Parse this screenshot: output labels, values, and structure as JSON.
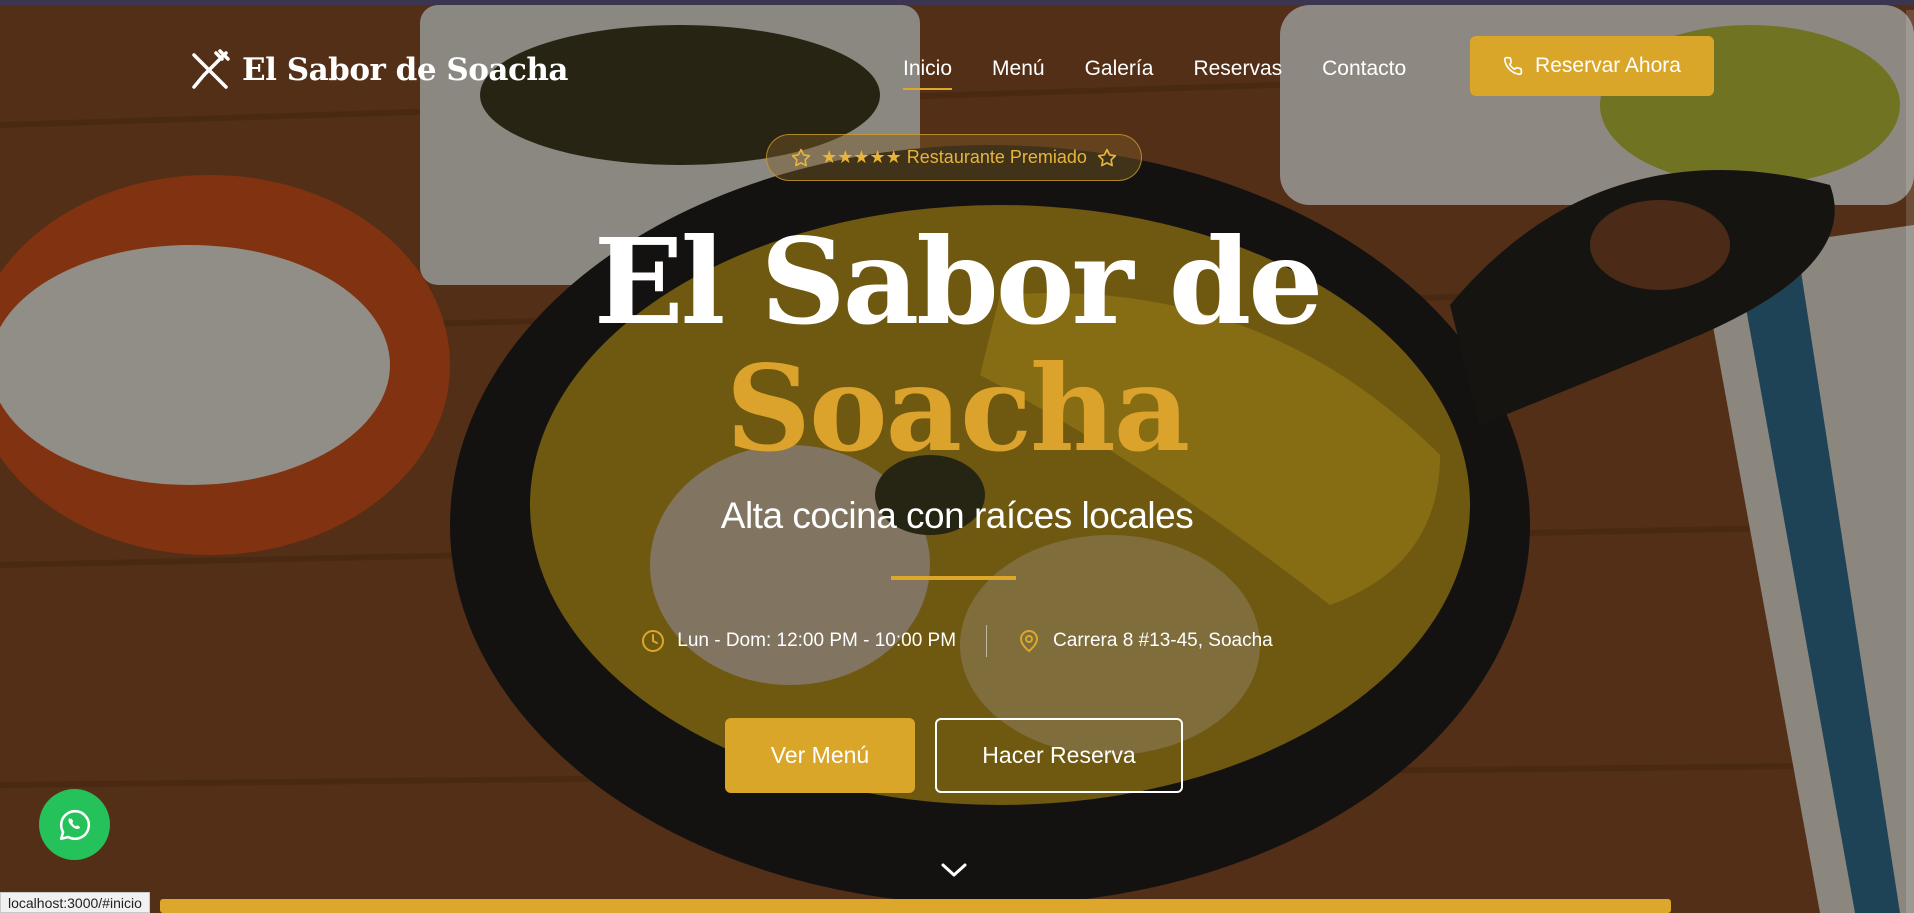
{
  "colors": {
    "accent": "#d9a62a",
    "whatsapp": "#25c15a",
    "text": "#ffffff"
  },
  "brand": {
    "name": "El Sabor de Soacha",
    "icon": "utensils-crossed-icon"
  },
  "nav": {
    "links": [
      {
        "label": "Inicio",
        "active": true
      },
      {
        "label": "Menú",
        "active": false
      },
      {
        "label": "Galería",
        "active": false
      },
      {
        "label": "Reservas",
        "active": false
      },
      {
        "label": "Contacto",
        "active": false
      }
    ],
    "cta_label": "Reservar Ahora",
    "cta_icon": "phone-icon"
  },
  "hero": {
    "badge": "★★★★★ Restaurante Premiado",
    "badge_icon": "star-outline-icon",
    "title_line1": "El Sabor de",
    "title_line2": "Soacha",
    "tagline": "Alta cocina con raíces locales",
    "hours": "Lun - Dom: 12:00 PM - 10:00 PM",
    "hours_icon": "clock-icon",
    "address": "Carrera 8 #13-45, Soacha",
    "address_icon": "map-pin-icon",
    "primary_button": "Ver Menú",
    "secondary_button": "Hacer Reserva",
    "scroll_icon": "chevron-down-icon"
  },
  "whatsapp": {
    "icon": "whatsapp-icon"
  },
  "scroll_progress": {
    "value": 0.89
  },
  "status_bar": {
    "url": "localhost:3000/#inicio"
  }
}
